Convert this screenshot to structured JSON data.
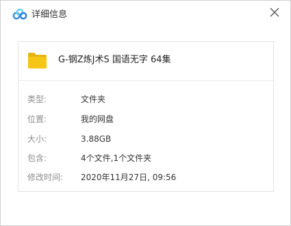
{
  "window": {
    "title": "详细信息",
    "close_glyph": "✕"
  },
  "colors": {
    "logo_blue": "#3a8ee6",
    "logo_cyan": "#5fd0f0",
    "folder_yellow": "#f5c518",
    "folder_tab": "#e6b511"
  },
  "icons": {
    "logo": "cloud-rings-logo-icon",
    "folder": "folder-icon",
    "close": "close-icon"
  },
  "file": {
    "name": "G-钢Z炼J术S 国语无字 64集"
  },
  "properties": [
    {
      "label": "类型:",
      "value": "文件夹"
    },
    {
      "label": "位置:",
      "value": "我的网盘"
    },
    {
      "label": "大小:",
      "value": "3.88GB"
    },
    {
      "label": "包含:",
      "value": "4个文件,1个文件夹"
    },
    {
      "label": "修改时间:",
      "value": "2020年11月27日, 09:56"
    }
  ]
}
